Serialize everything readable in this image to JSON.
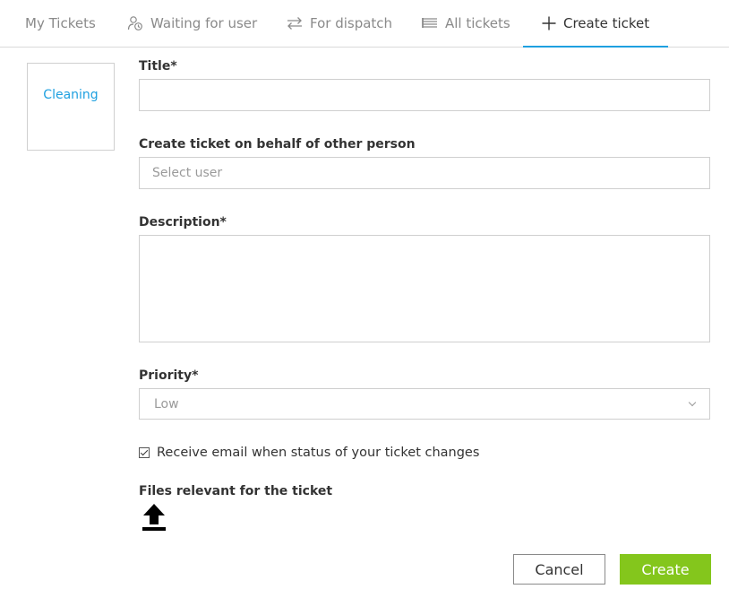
{
  "tabs": {
    "my_tickets": "My Tickets",
    "waiting_for_user": "Waiting for user",
    "for_dispatch": "For dispatch",
    "all_tickets": "All tickets",
    "create_ticket": "Create ticket",
    "active": "create_ticket"
  },
  "sidebar": {
    "category": "Cleaning"
  },
  "form": {
    "title_label": "Title*",
    "title_value": "",
    "behalf_label": "Create ticket on behalf of other person",
    "behalf_placeholder": "Select user",
    "description_label": "Description*",
    "description_value": "",
    "priority_label": "Priority*",
    "priority_value": "Low",
    "email_checkbox_label": "Receive email when status of your ticket changes",
    "email_checkbox_checked": true,
    "files_label": "Files relevant for the ticket"
  },
  "actions": {
    "cancel": "Cancel",
    "create": "Create"
  },
  "colors": {
    "accent": "#1ea0e0",
    "create_button": "#84c61c"
  },
  "icons": {
    "waiting": "user-clock-icon",
    "dispatch": "swap-arrows-icon",
    "all": "list-icon",
    "create": "plus-icon",
    "upload": "upload-icon"
  }
}
